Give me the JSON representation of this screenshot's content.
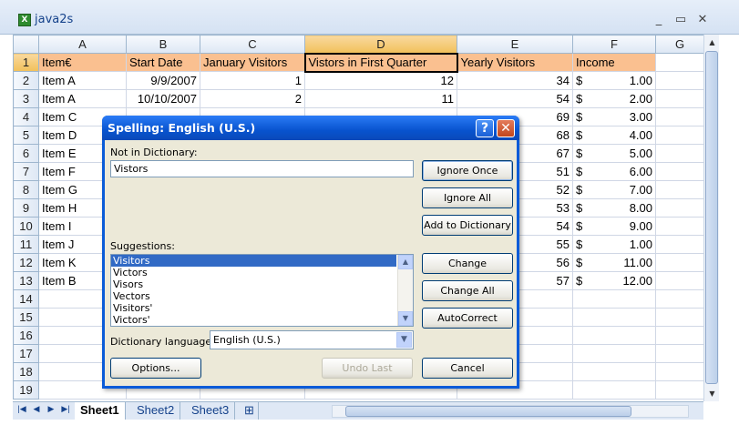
{
  "window": {
    "title": "java2s",
    "minimize": "_",
    "maximize": "▭",
    "close": "✕"
  },
  "columns": [
    "A",
    "B",
    "C",
    "D",
    "E",
    "F",
    "G"
  ],
  "rows": [
    {
      "n": "1",
      "a": "Item€",
      "b": "Start Date",
      "c": "January Visitors",
      "d": "Vistors in First Quarter",
      "e": "Yearly Visitors",
      "f_cur": "",
      "f": "Income"
    },
    {
      "n": "2",
      "a": "Item A",
      "b": "9/9/2007",
      "c": "1",
      "d": "12",
      "e": "34",
      "f_cur": "$",
      "f": "1.00"
    },
    {
      "n": "3",
      "a": "Item A",
      "b": "10/10/2007",
      "c": "2",
      "d": "11",
      "e": "54",
      "f_cur": "$",
      "f": "2.00"
    },
    {
      "n": "4",
      "a": "Item C",
      "b": "",
      "c": "",
      "d": "",
      "e": "69",
      "f_cur": "$",
      "f": "3.00"
    },
    {
      "n": "5",
      "a": "Item D",
      "b": "",
      "c": "",
      "d": "",
      "e": "68",
      "f_cur": "$",
      "f": "4.00"
    },
    {
      "n": "6",
      "a": "Item E",
      "b": "",
      "c": "",
      "d": "",
      "e": "67",
      "f_cur": "$",
      "f": "5.00"
    },
    {
      "n": "7",
      "a": "Item F",
      "b": "",
      "c": "",
      "d": "",
      "e": "51",
      "f_cur": "$",
      "f": "6.00"
    },
    {
      "n": "8",
      "a": "Item G",
      "b": "",
      "c": "",
      "d": "",
      "e": "52",
      "f_cur": "$",
      "f": "7.00"
    },
    {
      "n": "9",
      "a": "Item H",
      "b": "",
      "c": "",
      "d": "",
      "e": "53",
      "f_cur": "$",
      "f": "8.00"
    },
    {
      "n": "10",
      "a": "Item I",
      "b": "",
      "c": "",
      "d": "",
      "e": "54",
      "f_cur": "$",
      "f": "9.00"
    },
    {
      "n": "11",
      "a": "Item J",
      "b": "",
      "c": "",
      "d": "",
      "e": "55",
      "f_cur": "$",
      "f": "1.00"
    },
    {
      "n": "12",
      "a": "Item K",
      "b": "",
      "c": "",
      "d": "",
      "e": "56",
      "f_cur": "$",
      "f": "11.00"
    },
    {
      "n": "13",
      "a": "Item B",
      "b": "",
      "c": "",
      "d": "",
      "e": "57",
      "f_cur": "$",
      "f": "12.00"
    },
    {
      "n": "14",
      "a": "",
      "b": "",
      "c": "",
      "d": "",
      "e": "",
      "f_cur": "",
      "f": ""
    },
    {
      "n": "15",
      "a": "",
      "b": "",
      "c": "",
      "d": "",
      "e": "",
      "f_cur": "",
      "f": ""
    },
    {
      "n": "16",
      "a": "",
      "b": "",
      "c": "",
      "d": "",
      "e": "",
      "f_cur": "",
      "f": ""
    },
    {
      "n": "17",
      "a": "",
      "b": "",
      "c": "",
      "d": "",
      "e": "",
      "f_cur": "",
      "f": ""
    },
    {
      "n": "18",
      "a": "",
      "b": "",
      "c": "",
      "d": "",
      "e": "",
      "f_cur": "",
      "f": ""
    },
    {
      "n": "19",
      "a": "",
      "b": "",
      "c": "",
      "d": "",
      "e": "",
      "f_cur": "",
      "f": ""
    }
  ],
  "sheets": [
    "Sheet1",
    "Sheet2",
    "Sheet3"
  ],
  "dialog": {
    "title": "Spelling: English (U.S.)",
    "help": "?",
    "close": "✕",
    "not_in_dict_label": "Not in Dictionary:",
    "not_in_dict_value": "Vistors",
    "suggestions_label": "Suggestions:",
    "suggestions": [
      "Visitors",
      "Victors",
      "Visors",
      "Vectors",
      "Visitors'",
      "Victors'"
    ],
    "dict_lang_label": "Dictionary language:",
    "dict_lang_value": "English (U.S.)",
    "buttons": {
      "ignore_once": "Ignore Once",
      "ignore_all": "Ignore All",
      "add_to_dictionary": "Add to Dictionary",
      "change": "Change",
      "change_all": "Change All",
      "autocorrect": "AutoCorrect",
      "options": "Options...",
      "undo_last": "Undo Last",
      "cancel": "Cancel"
    }
  }
}
